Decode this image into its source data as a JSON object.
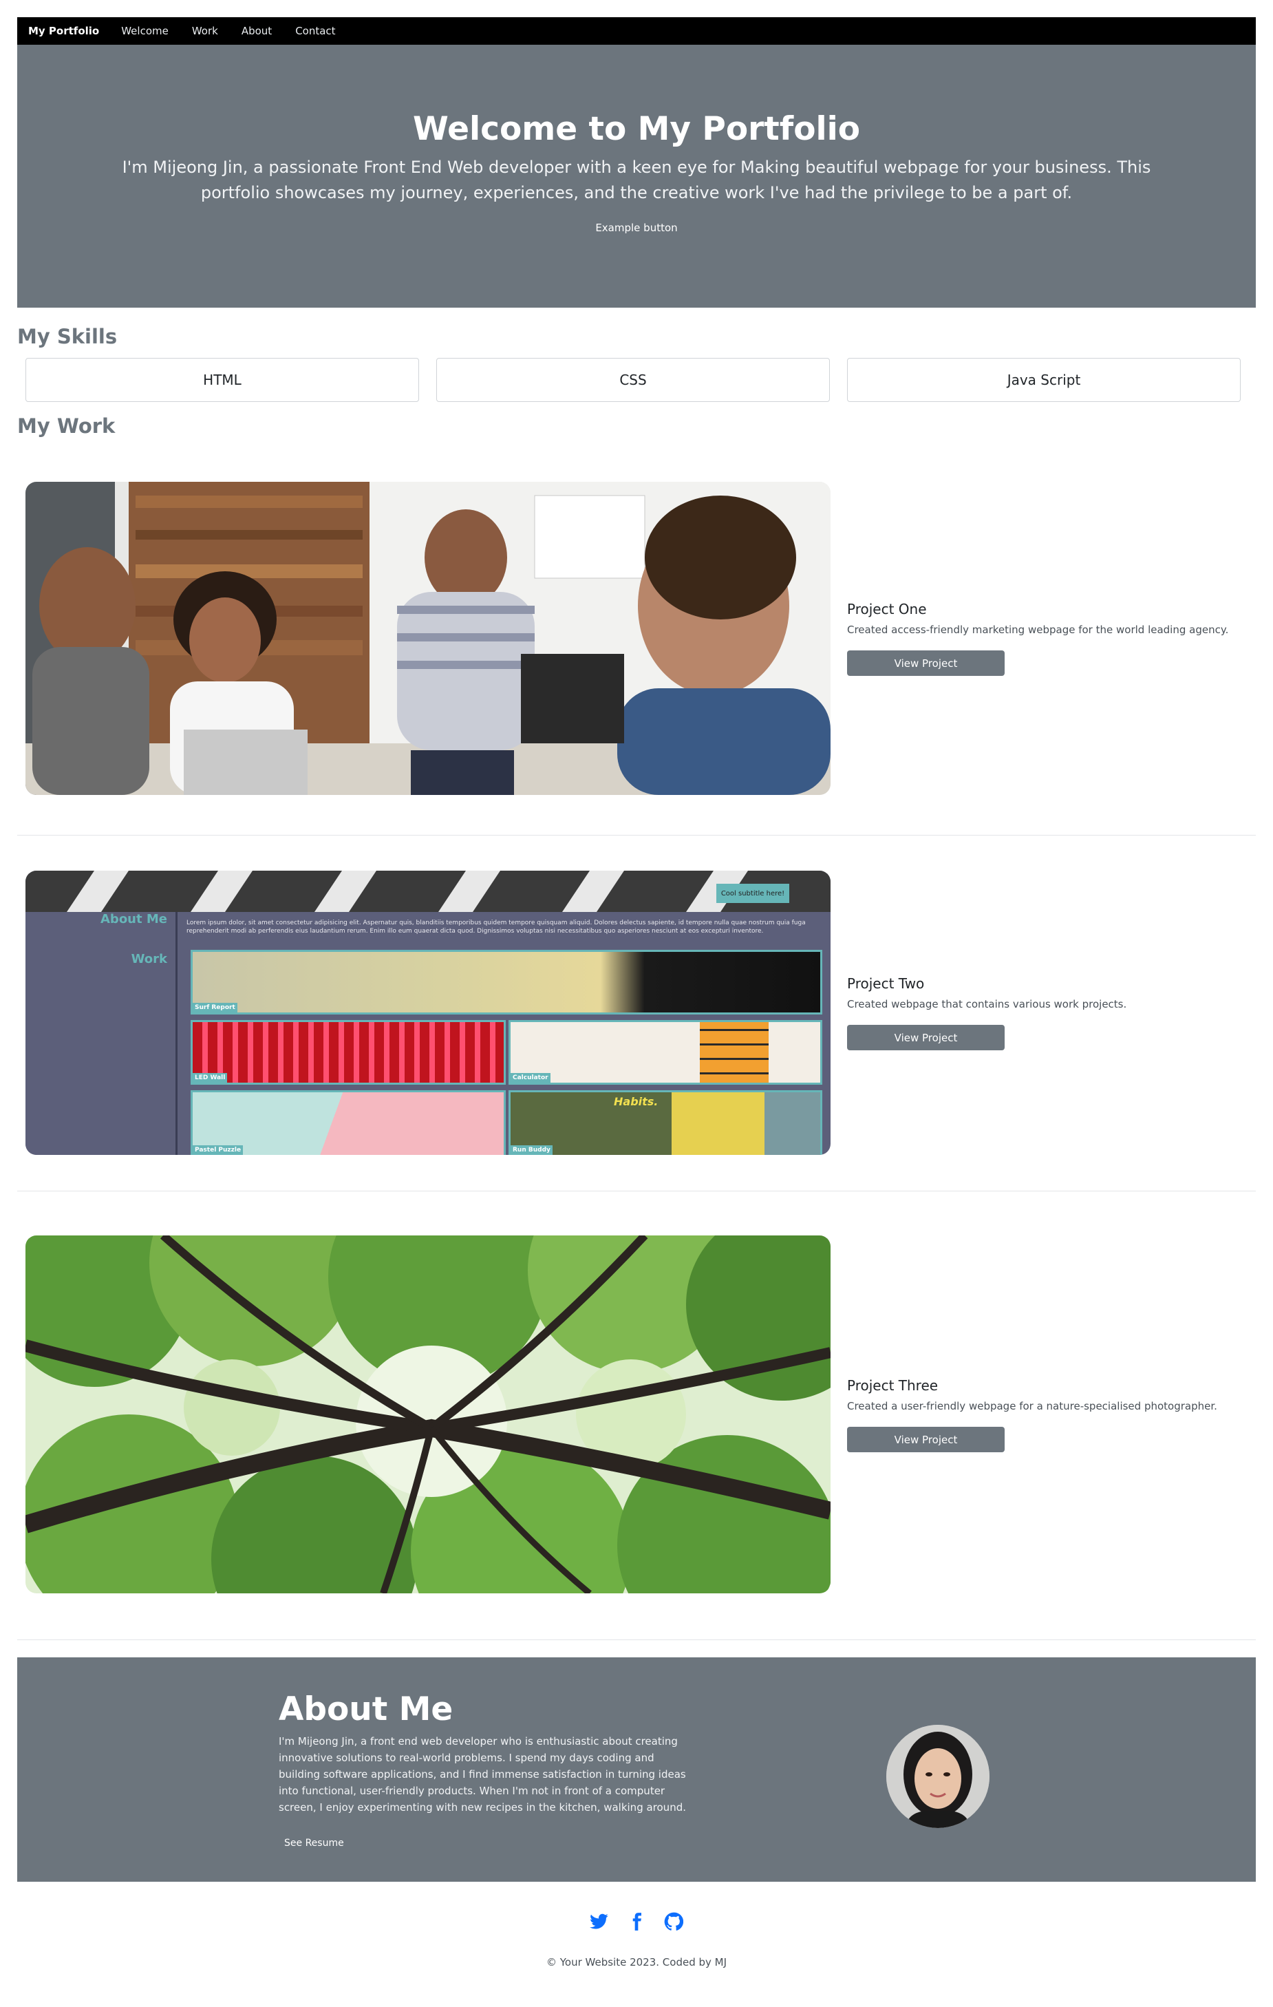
{
  "nav": {
    "brand": "My Portfolio",
    "links": [
      "Welcome",
      "Work",
      "About",
      "Contact"
    ]
  },
  "hero": {
    "title": "Welcome to My Portfolio",
    "text": "I'm Mijeong Jin, a passionate Front End Web developer with a keen eye for Making beautiful webpage for your business. This portfolio showcases my journey, experiences, and the creative work I've had the privilege to be a part of.",
    "button": "Example button"
  },
  "skills": {
    "title": "My Skills",
    "items": [
      "HTML",
      "CSS",
      "Java Script"
    ]
  },
  "work": {
    "title": "My Work",
    "projects": [
      {
        "title": "Project One",
        "desc": "Created access-friendly marketing webpage for the world leading agency.",
        "button": "View Project"
      },
      {
        "title": "Project Two",
        "desc": "Created webpage that contains various work projects.",
        "button": "View Project",
        "preview": {
          "sidebar": [
            "About Me",
            "Work"
          ],
          "badge": "Cool subtitle here!",
          "intro": "Lorem ipsum dolor, sit amet consectetur adipisicing elit. Aspernatur quis, blanditiis temporibus quidem tempore quisquam aliquid. Dolores delectus sapiente, id tempore nulla quae nostrum quia fuga reprehenderit modi ab perferendis eius laudantium rerum. Enim illo eum quaerat dicta quod. Dignissimos voluptas nisi necessitatibus quo asperiores nesciunt at eos excepturi inventore.",
          "tiles": [
            "Surf Report",
            "LED Wall",
            "Calculator",
            "Pastel Puzzle",
            "Run Buddy"
          ],
          "habits": "Habits."
        }
      },
      {
        "title": "Project Three",
        "desc": "Created a user-friendly webpage for a nature-specialised photographer.",
        "button": "View Project"
      }
    ]
  },
  "about": {
    "title": "About Me",
    "text": "I'm Mijeong Jin, a front end web developer who is enthusiastic about creating innovative solutions to real-world problems. I spend my days coding and building software applications, and I find immense satisfaction in turning ideas into functional, user-friendly products. When I'm not in front of a computer screen, I enjoy experimenting with new recipes in the kitchen, walking around.",
    "button": "See Resume"
  },
  "footer": {
    "icons": [
      "twitter-icon",
      "facebook-icon",
      "github-icon"
    ],
    "copyright": "© Your Website 2023. Coded by MJ"
  },
  "colors": {
    "nav_bg": "#000000",
    "section_gray": "#6c757d",
    "social_blue": "#0d6efd",
    "preview_sidebar": "#5c5f7a",
    "preview_accent": "#66b6b8"
  }
}
